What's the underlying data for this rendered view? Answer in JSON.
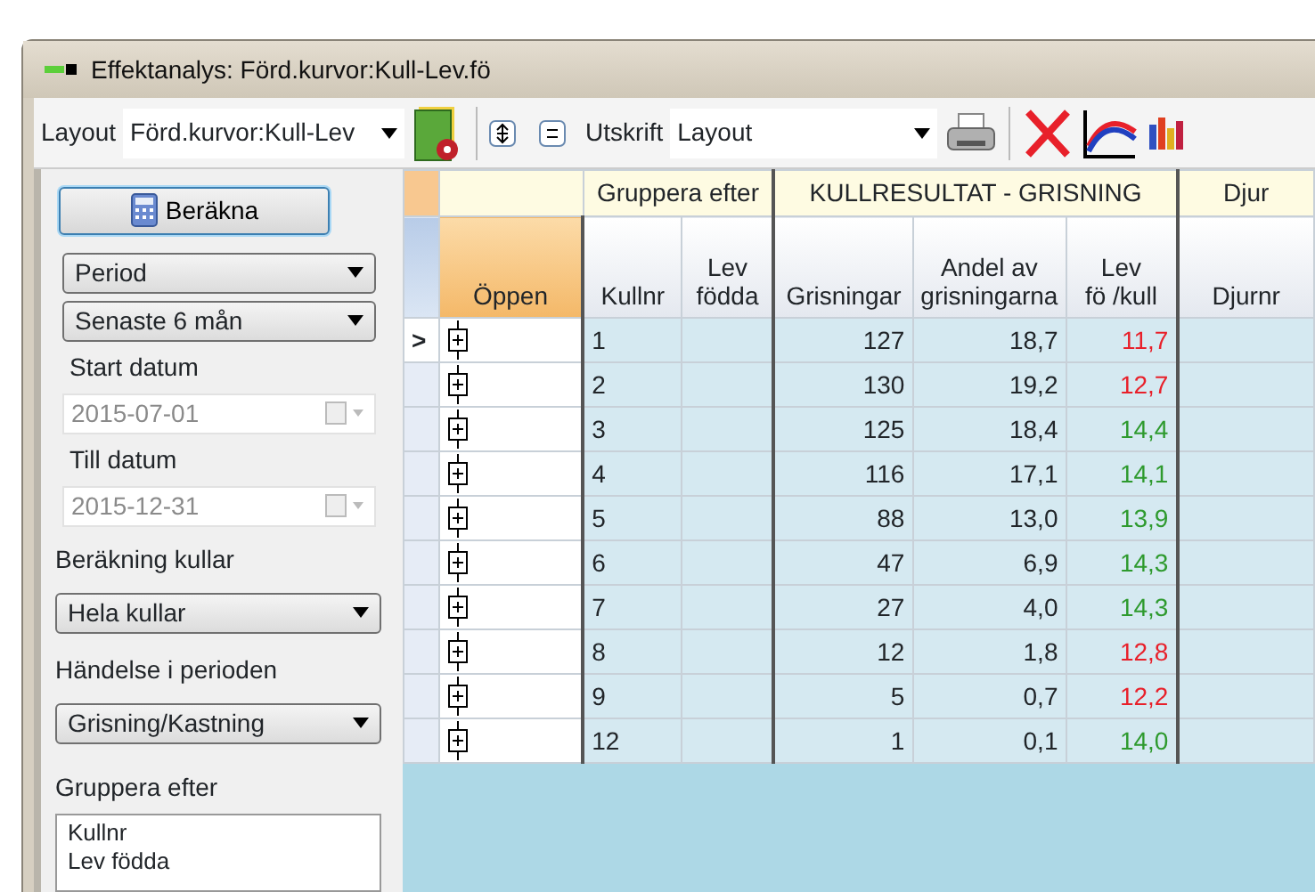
{
  "window": {
    "title": "Effektanalys: Förd.kurvor:Kull-Lev.fö"
  },
  "toolbar": {
    "layout_label": "Layout",
    "layout_value": "Förd.kurvor:Kull-Lev",
    "print_label": "Utskrift",
    "print_value": "Layout"
  },
  "sidebar": {
    "calc_button": "Beräkna",
    "period_select": "Period",
    "range_select": "Senaste 6 mån",
    "start_label": "Start datum",
    "start_value": "2015-07-01",
    "start_disabled": true,
    "end_label": "Till datum",
    "end_value": "2015-12-31",
    "end_disabled": true,
    "litter_label": "Beräkning kullar",
    "litter_select": "Hela kullar",
    "event_label": "Händelse i perioden",
    "event_select": "Grisning/Kastning",
    "group_label": "Gruppera efter",
    "group_items": [
      "Kullnr",
      "Lev födda"
    ]
  },
  "grid": {
    "group_headers": [
      {
        "label": "Gruppera efter"
      },
      {
        "label": "KULLRESULTAT - GRISNING"
      },
      {
        "label": "Djur"
      }
    ],
    "columns": [
      "Öppen",
      "Kullnr",
      "Lev\nfödda",
      "Grisningar",
      "Andel av\ngrisningarna",
      "Lev\nfö /kull",
      "Djurnr"
    ],
    "current_marker": ">",
    "rows": [
      {
        "current": true,
        "kullnr": "1",
        "grisningar": "127",
        "andel": "18,7",
        "lev": "11,7",
        "color": "#e8202a"
      },
      {
        "current": false,
        "kullnr": "2",
        "grisningar": "130",
        "andel": "19,2",
        "lev": "12,7",
        "color": "#e8202a"
      },
      {
        "current": false,
        "kullnr": "3",
        "grisningar": "125",
        "andel": "18,4",
        "lev": "14,4",
        "color": "#2e9a2e"
      },
      {
        "current": false,
        "kullnr": "4",
        "grisningar": "116",
        "andel": "17,1",
        "lev": "14,1",
        "color": "#2e9a2e"
      },
      {
        "current": false,
        "kullnr": "5",
        "grisningar": "88",
        "andel": "13,0",
        "lev": "13,9",
        "color": "#2e9a2e"
      },
      {
        "current": false,
        "kullnr": "6",
        "grisningar": "47",
        "andel": "6,9",
        "lev": "14,3",
        "color": "#2e9a2e"
      },
      {
        "current": false,
        "kullnr": "7",
        "grisningar": "27",
        "andel": "4,0",
        "lev": "14,3",
        "color": "#2e9a2e"
      },
      {
        "current": false,
        "kullnr": "8",
        "grisningar": "12",
        "andel": "1,8",
        "lev": "12,8",
        "color": "#e8202a"
      },
      {
        "current": false,
        "kullnr": "9",
        "grisningar": "5",
        "andel": "0,7",
        "lev": "12,2",
        "color": "#e8202a"
      },
      {
        "current": false,
        "kullnr": "12",
        "grisningar": "1",
        "andel": "0,1",
        "lev": "14,0",
        "color": "#2e9a2e"
      }
    ]
  }
}
